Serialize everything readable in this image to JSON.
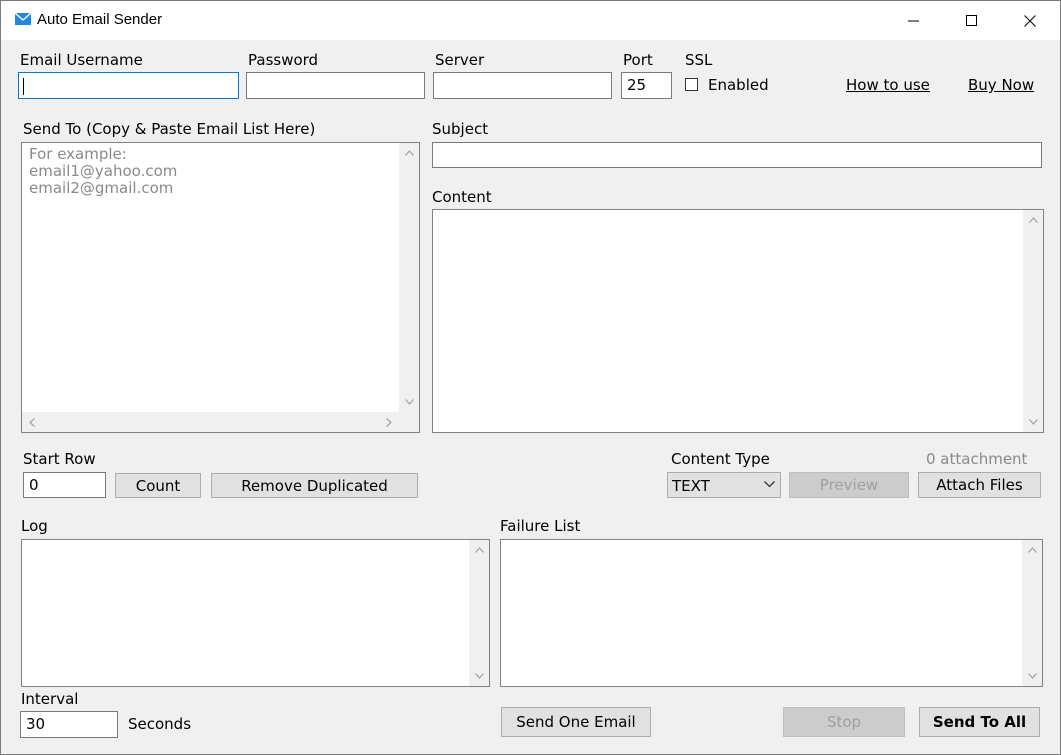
{
  "window": {
    "title": "Auto Email Sender"
  },
  "settings": {
    "username_label": "Email Username",
    "username_value": "",
    "password_label": "Password",
    "password_value": "",
    "server_label": "Server",
    "server_value": "",
    "port_label": "Port",
    "port_value": "25",
    "ssl_label": "SSL",
    "ssl_checkbox_label": "Enabled",
    "ssl_enabled": false,
    "how_to_use_link": "How to use",
    "buy_now_link": "Buy Now"
  },
  "recipients": {
    "label": "Send To (Copy & Paste Email List Here)",
    "placeholder": "For example:\nemail1@yahoo.com\nemail2@gmail.com"
  },
  "message": {
    "subject_label": "Subject",
    "subject_value": "",
    "content_label": "Content",
    "content_value": ""
  },
  "list_tools": {
    "start_row_label": "Start Row",
    "start_row_value": "0",
    "count_button": "Count",
    "remove_duplicated_button": "Remove Duplicated"
  },
  "content_options": {
    "content_type_label": "Content Type",
    "content_type_value": "TEXT",
    "attachment_count": "0 attachment",
    "preview_button": "Preview",
    "attach_files_button": "Attach Files"
  },
  "log": {
    "label": "Log",
    "failure_label": "Failure List"
  },
  "footer": {
    "interval_label": "Interval",
    "interval_value": "30",
    "seconds_label": "Seconds",
    "send_one_button": "Send One Email",
    "stop_button": "Stop",
    "send_all_button": "Send To All"
  },
  "colors": {
    "focus_border": "#0078d7",
    "disabled_text": "#a0a0a0"
  }
}
